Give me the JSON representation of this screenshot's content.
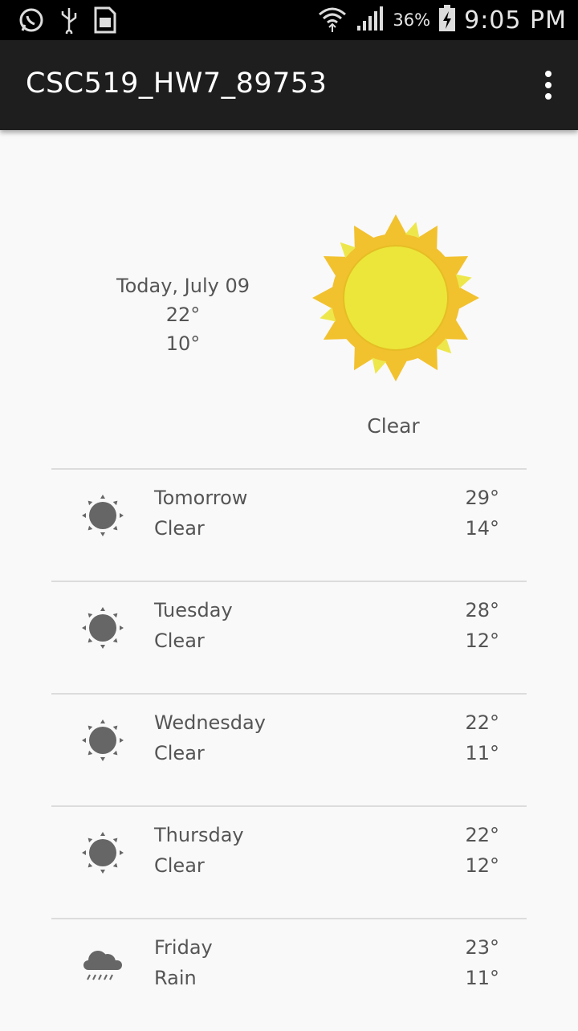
{
  "status_bar": {
    "battery_percent": "36%",
    "time": "9:05 PM"
  },
  "app_bar": {
    "title": "CSC519_HW7_89753"
  },
  "today": {
    "date": "Today, July 09",
    "high": "22°",
    "low": "10°",
    "description": "Clear",
    "icon": "sun-icon"
  },
  "forecast": [
    {
      "day": "Tomorrow",
      "description": "Clear",
      "high": "29°",
      "low": "14°",
      "icon": "clear-icon"
    },
    {
      "day": "Tuesday",
      "description": "Clear",
      "high": "28°",
      "low": "12°",
      "icon": "clear-icon"
    },
    {
      "day": "Wednesday",
      "description": "Clear",
      "high": "22°",
      "low": "11°",
      "icon": "clear-icon"
    },
    {
      "day": "Thursday",
      "description": "Clear",
      "high": "22°",
      "low": "12°",
      "icon": "clear-icon"
    },
    {
      "day": "Friday",
      "description": "Rain",
      "high": "23°",
      "low": "11°",
      "icon": "rain-icon"
    }
  ],
  "colors": {
    "sun_outer": "#f2c12e",
    "sun_inner": "#ece63a",
    "icon_gray": "#666666"
  }
}
